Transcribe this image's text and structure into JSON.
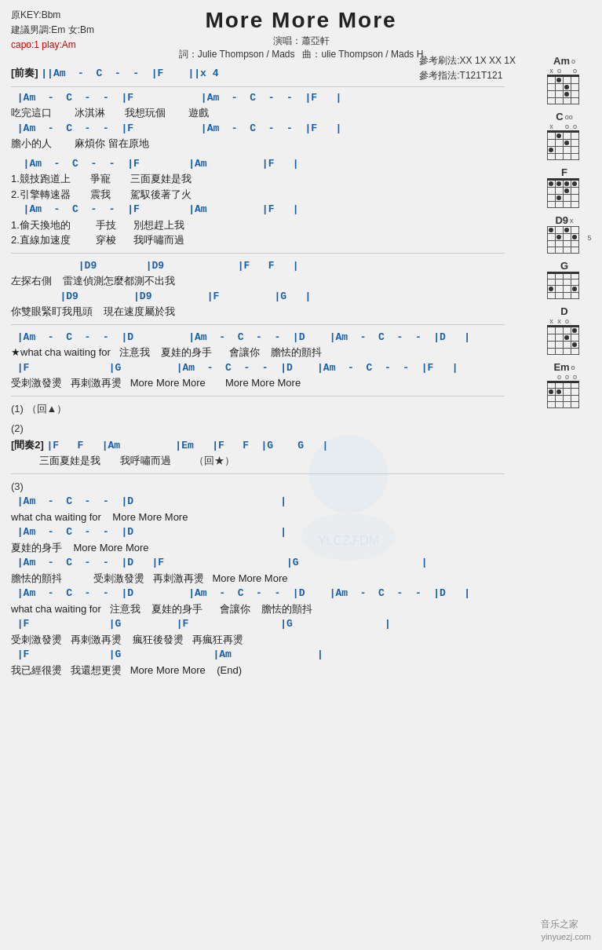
{
  "title": "More More More",
  "meta": {
    "original_key": "原KEY:Bbm",
    "suggested": "建議男調:Em 女:Bm",
    "capo": "capo:1 play:Am",
    "singer": "演唱：蕭亞軒",
    "lyrics": "詞：Julie Thompson / Mads",
    "music": "曲：ulie Thompson / Mads H"
  },
  "ref": {
    "strum": "參考刷法:XX 1X XX 1X",
    "finger": "參考指法:T121T121"
  },
  "sections": {
    "intro_label": "[前奏]",
    "intro_chords": "||Am  -  C  -  -  |F    ||x 4"
  },
  "footer": {
    "site": "音乐之家",
    "url": "yinyuezj.com"
  }
}
